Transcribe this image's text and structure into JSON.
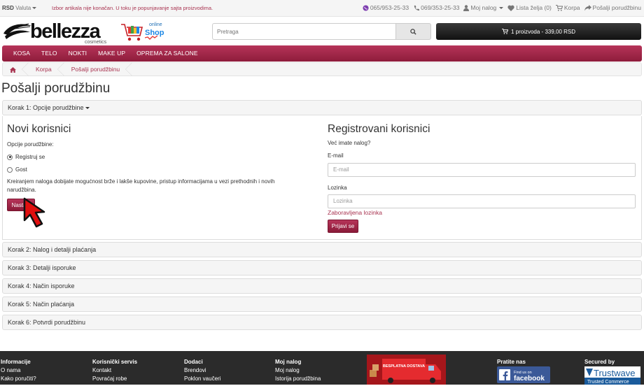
{
  "topbar": {
    "currency_code": "RSD",
    "currency_label": "Valuta",
    "notice": "Izbor artikala nije konačan. U toku je popunjavanje sajta proizvodima.",
    "phone1": "065/953-25-33",
    "phone2": "069/353-25-33",
    "account": "Moj nalog",
    "wishlist": "Lista želja (0)",
    "cart": "Korpa",
    "checkout": "Pošalji porudžbinu"
  },
  "header": {
    "logo_text": "bellezza",
    "logo_sub": "cosmetics",
    "shop_online": "online",
    "shop_text": "Shop",
    "search_placeholder": "Pretraga",
    "cart_button": "1 proizvoda - 339,00 RSD"
  },
  "nav": {
    "items": [
      "KOSA",
      "TELO",
      "NOKTI",
      "MAKE UP",
      "OPREMA ZA SALONE"
    ]
  },
  "breadcrumb": {
    "items": [
      "Korpa",
      "Pošalji porudžbinu"
    ]
  },
  "page": {
    "title": "Pošalji porudžbinu"
  },
  "steps": {
    "step1": "Korak 1: Opcije porudžbine",
    "step2": "Korak 2: Nalog i detalji plaćanja",
    "step3": "Korak 3: Detalji isporuke",
    "step4": "Korak 4: Način isporuke",
    "step5": "Korak 5: Način plaćanja",
    "step6": "Korak 6: Potvrdi porudžbinu"
  },
  "new_customer": {
    "title": "Novi korisnici",
    "options_label": "Opcije porudžbine:",
    "option_register": "Registruj se",
    "option_guest": "Gost",
    "description": "Kreiranjem naloga dobijate mogućnost brže i lakše kupovine, pristup informacijama u vezi prethodnih i novih narudžbina.",
    "continue_button": "Nastavi"
  },
  "returning_customer": {
    "title": "Registrovani korisnici",
    "subtitle": "Već imate nalog?",
    "email_label": "E-mail",
    "email_placeholder": "E-mail",
    "password_label": "Lozinka",
    "password_placeholder": "Lozinka",
    "forgot_link": "Zaboravljena lozinka",
    "login_button": "Prijavi se"
  },
  "footer": {
    "info": {
      "heading": "Informacije",
      "links": [
        "O nama",
        "Kako poručiti?"
      ]
    },
    "service": {
      "heading": "Korisnički servis",
      "links": [
        "Kontakt",
        "Povraćaj robe"
      ]
    },
    "extras": {
      "heading": "Dodaci",
      "links": [
        "Brendovi",
        "Poklon vaučeri"
      ]
    },
    "account": {
      "heading": "Moj nalog",
      "links": [
        "Moj nalog",
        "Istorija porudžbina"
      ]
    },
    "truck_text": "BESPLATNA DOSTAVA",
    "follow": {
      "heading": "Pratite nas",
      "fb_small": "Find us on",
      "fb_big": "facebook"
    },
    "secured": {
      "heading": "Secured by",
      "brand": "Trustwave",
      "sub": "Trusted Commerce"
    }
  },
  "colors": {
    "brand": "#a8324f",
    "nav_top": "#b63459",
    "nav_bottom": "#8e1c3b",
    "footer": "#2b2b2b"
  }
}
